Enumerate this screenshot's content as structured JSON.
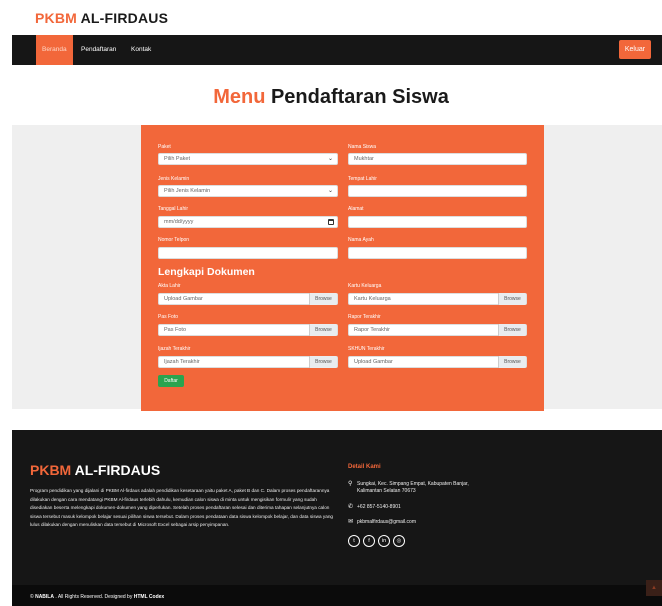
{
  "brand": {
    "accent": "PKBM",
    "rest": "AL-FIRDAUS"
  },
  "nav": {
    "items": [
      "Beranda",
      "Pendaftaran",
      "Kontak"
    ],
    "logout_label": "Keluar"
  },
  "page_title": {
    "accent": "Menu",
    "rest": "Pendaftaran Siswa"
  },
  "form": {
    "paket": {
      "label": "Paket",
      "value": "Pilih Paket"
    },
    "nama_siswa": {
      "label": "Nama Siswa",
      "value": "Mukhtar"
    },
    "jenis_kelamin": {
      "label": "Jenis Kelamin",
      "value": "Pilih Jenis Kelamin"
    },
    "tempat_lahir": {
      "label": "Tempat Lahir",
      "value": ""
    },
    "tanggal_lahir": {
      "label": "Tanggal Lahir",
      "value": "mm/dd/yyyy"
    },
    "alamat": {
      "label": "Alamat",
      "value": ""
    },
    "nomor_telpon": {
      "label": "Nomor Telpon",
      "value": ""
    },
    "nama_ayah": {
      "label": "Nama Ayah",
      "value": ""
    }
  },
  "documents": {
    "title": "Lengkapi Dokumen",
    "browse_label": "Browse",
    "akta_lahir": {
      "label": "Akta Lahir",
      "placeholder": "Upload Gambar"
    },
    "kartu_keluarga": {
      "label": "Kartu Keluarga",
      "placeholder": "Kartu Keluarga"
    },
    "pas_foto": {
      "label": "Pas Foto",
      "placeholder": "Pas Foto"
    },
    "rapor_terakhir": {
      "label": "Rapor Terakhir",
      "placeholder": "Rapor Terakhir"
    },
    "ijazah_terakhir": {
      "label": "Ijazah Terakhir",
      "placeholder": "Ijazah Terakhir"
    },
    "skhun_terakhir": {
      "label": "SKHUN Terakhir",
      "placeholder": "Upload Gambar"
    },
    "submit_label": "Daftar"
  },
  "footer": {
    "brand": {
      "accent": "PKBM",
      "rest": "AL-FIRDAUS"
    },
    "description": "Program pendidikan yang dijalani di PKBM Al-firdaus adalah pendidikan kesetaraan yaitu paket A, paket B dan C. Dalam proses pendaftarannya dilakukan dengan cara mendatangi PKBM Al-firdaus terlebih dahulu, kemudian calon siswa di minta untuk mengisikan formulir yang sudah disediakan beserta melengkapi dokumen-dokumen yang diperlukan. Setelah proses pendaftaran selesai dan diterima tahapan selanjutnya calon siswa tersebut masuk kelompok belajar sesuai pilihan siswa tersebut. Dalam proses pendataan data siswa kelompok belajar, dan data siswa yang lulus dilakukan dengan menuliskan data tersebut di Microsoft Excel sebagai arsip penyimpanan.",
    "contact_title": "Detail Kami",
    "address_line1": "Sungkai, Kec. Simpang Empat, Kabupaten Banjar,",
    "address_line2": "Kalimantan Selatan 70673",
    "phone": "+62 857-5140-8901",
    "email": "pkbmalfirdaus@gmail.com",
    "social_icons": [
      "twitter-icon",
      "facebook-icon",
      "linkedin-icon",
      "instagram-icon"
    ]
  },
  "copyright": {
    "prefix": "©",
    "owner": "NABILA",
    "middle": ". All Rights Reserved. Designed by",
    "designer": "HTML Codex"
  },
  "colors": {
    "accent": "#f2673a",
    "dark": "#161616",
    "success": "#2aa44f"
  }
}
